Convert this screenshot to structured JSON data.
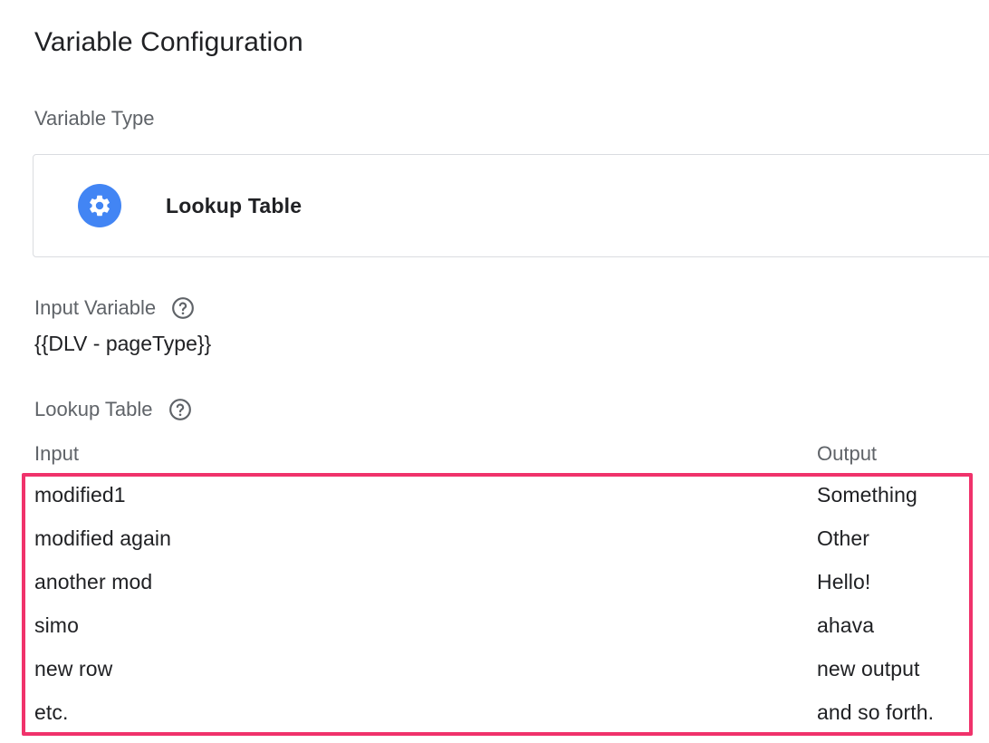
{
  "panel": {
    "title": "Variable Configuration"
  },
  "variable_type": {
    "label": "Variable Type",
    "selected": "Lookup Table",
    "icon": "gear-icon",
    "icon_color": "#4285f4"
  },
  "input_variable": {
    "label": "Input Variable",
    "value": "{{DLV - pageType}}",
    "help_icon": "help-circle-icon"
  },
  "lookup_table": {
    "label": "Lookup Table",
    "help_icon": "help-circle-icon",
    "columns": {
      "input": "Input",
      "output": "Output"
    },
    "rows": [
      {
        "input": "modified1",
        "output": "Something"
      },
      {
        "input": "modified again",
        "output": "Other"
      },
      {
        "input": "another mod",
        "output": "Hello!"
      },
      {
        "input": "simo",
        "output": "ahava"
      },
      {
        "input": "new row",
        "output": "new output"
      },
      {
        "input": "etc.",
        "output": "and so forth."
      }
    ],
    "highlight_color": "#f0326b"
  }
}
